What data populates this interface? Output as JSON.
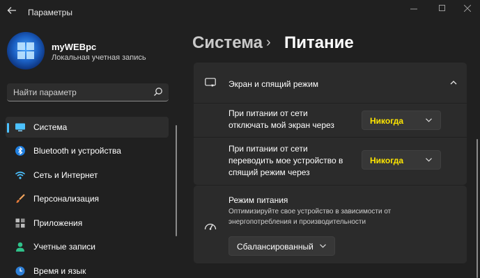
{
  "window": {
    "title": "Параметры"
  },
  "profile": {
    "name": "myWEBpc",
    "account_type": "Локальная учетная запись"
  },
  "search": {
    "placeholder": "Найти параметр"
  },
  "sidebar": {
    "items": [
      {
        "label": "Система",
        "icon": "monitor-icon",
        "active": true
      },
      {
        "label": "Bluetooth и устройства",
        "icon": "bluetooth-icon"
      },
      {
        "label": "Сеть и Интернет",
        "icon": "wifi-icon"
      },
      {
        "label": "Персонализация",
        "icon": "brush-icon"
      },
      {
        "label": "Приложения",
        "icon": "apps-icon"
      },
      {
        "label": "Учетные записи",
        "icon": "person-icon"
      },
      {
        "label": "Время и язык",
        "icon": "globe-clock-icon"
      }
    ]
  },
  "breadcrumb": {
    "parent": "Система",
    "separator": "›",
    "current": "Питание"
  },
  "screen_sleep": {
    "title": "Экран и спящий режим",
    "rows": [
      {
        "label_line1": "При питании от сети",
        "label_line2": "отключать мой экран через",
        "value": "Никогда"
      },
      {
        "label_line1": "При питании от сети",
        "label_line2": "переводить мое устройство в",
        "label_line3": "спящий режим через",
        "value": "Никогда"
      }
    ]
  },
  "power_mode": {
    "title": "Режим питания",
    "description": "Оптимизируйте свое устройство в зависимости от энергопотребления и производительности",
    "value": "Сбалансированный"
  },
  "colors": {
    "background": "#202020",
    "card": "#2b2b2b",
    "accent": "#4cc2ff",
    "dropdown_value_highlight": "#ffe600"
  }
}
